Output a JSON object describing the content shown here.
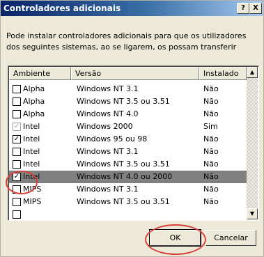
{
  "window": {
    "title": "Controladores adicionais",
    "help_label": "?",
    "close_label": "X"
  },
  "description": "Pode instalar controladores adicionais para que os utilizadores dos seguintes sistemas, ao se ligarem, os possam transferir",
  "table": {
    "headers": [
      "Ambiente",
      "Versão",
      "Instalado"
    ],
    "rows": [
      {
        "env": "Alpha",
        "version": "Windows NT 3.1",
        "installed": "Não",
        "checked": false,
        "disabled": false,
        "selected": false
      },
      {
        "env": "Alpha",
        "version": "Windows NT 3.5 ou 3.51",
        "installed": "Não",
        "checked": false,
        "disabled": false,
        "selected": false
      },
      {
        "env": "Alpha",
        "version": "Windows NT 4.0",
        "installed": "Não",
        "checked": false,
        "disabled": false,
        "selected": false
      },
      {
        "env": "Intel",
        "version": "Windows 2000",
        "installed": "Sim",
        "checked": true,
        "disabled": true,
        "selected": false
      },
      {
        "env": "Intel",
        "version": "Windows 95 ou 98",
        "installed": "Não",
        "checked": true,
        "disabled": false,
        "selected": false
      },
      {
        "env": "Intel",
        "version": "Windows NT 3.1",
        "installed": "Não",
        "checked": false,
        "disabled": false,
        "selected": false
      },
      {
        "env": "Intel",
        "version": "Windows NT 3.5 ou 3.51",
        "installed": "Não",
        "checked": false,
        "disabled": false,
        "selected": false
      },
      {
        "env": "Intel",
        "version": "Windows NT 4.0 ou 2000",
        "installed": "Não",
        "checked": true,
        "disabled": false,
        "selected": true
      },
      {
        "env": "MIPS",
        "version": "Windows NT 3.1",
        "installed": "Não",
        "checked": false,
        "disabled": false,
        "selected": false
      },
      {
        "env": "MIPS",
        "version": "Windows NT 3.5 ou 3.51",
        "installed": "Não",
        "checked": false,
        "disabled": false,
        "selected": false
      },
      {
        "env": "",
        "version": "",
        "installed": "",
        "checked": false,
        "disabled": false,
        "selected": false
      }
    ]
  },
  "buttons": {
    "ok": "OK",
    "cancel": "Cancelar"
  },
  "colors": {
    "annotation": "#d9403a",
    "selection": "#808080"
  }
}
